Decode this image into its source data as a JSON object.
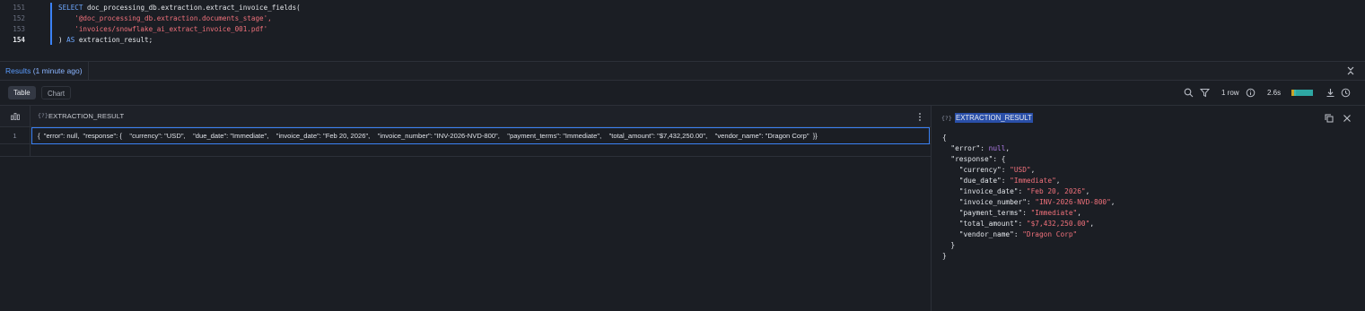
{
  "editor": {
    "lines": [
      {
        "num": "151",
        "keyword": "SELECT",
        "text": " doc_processing_db.extraction.extract_invoice_fields("
      },
      {
        "num": "152",
        "text": "    '@doc_processing_db.extraction.documents_stage',"
      },
      {
        "num": "153",
        "text": "    'invoices/snowflake_ai_extract_invoice_001.pdf'"
      },
      {
        "num": "154",
        "pre": ") ",
        "keyword": "AS",
        "text": " extraction_result;"
      }
    ]
  },
  "results": {
    "tab_label": "Results",
    "tab_sub": "(1 minute ago)",
    "views": {
      "table": "Table",
      "chart": "Chart"
    },
    "row_count": "1 row",
    "duration": "2.6s",
    "timing_colors": [
      "#c9a227",
      "#3bb6b0",
      "#2ea7a3"
    ]
  },
  "grid": {
    "column_type": "{?}",
    "column_name": "EXTRACTION_RESULT",
    "rows": [
      {
        "num": "1",
        "value": "{  \"error\": null,  \"response\": {    \"currency\": \"USD\",    \"due_date\": \"Immediate\",    \"invoice_date\": \"Feb 20, 2026\",    \"invoice_number\": \"INV-2026-NVD-800\",    \"payment_terms\": \"Immediate\",    \"total_amount\": \"$7,432,250.00\",    \"vendor_name\": \"Dragon Corp\"  }}"
      }
    ]
  },
  "detail": {
    "type": "{?}",
    "title": "EXTRACTION_RESULT",
    "json": {
      "open": "{",
      "error_key": "\"error\"",
      "error_val": "null",
      "response_key": "\"response\"",
      "fields": [
        {
          "key": "\"currency\"",
          "val": "\"USD\""
        },
        {
          "key": "\"due_date\"",
          "val": "\"Immediate\""
        },
        {
          "key": "\"invoice_date\"",
          "val": "\"Feb 20, 2026\""
        },
        {
          "key": "\"invoice_number\"",
          "val": "\"INV-2026-NVD-800\""
        },
        {
          "key": "\"payment_terms\"",
          "val": "\"Immediate\""
        },
        {
          "key": "\"total_amount\"",
          "val": "\"$7,432,250.00\""
        },
        {
          "key": "\"vendor_name\"",
          "val": "\"Dragon Corp\""
        }
      ],
      "inner_close": "}",
      "close": "}"
    }
  }
}
